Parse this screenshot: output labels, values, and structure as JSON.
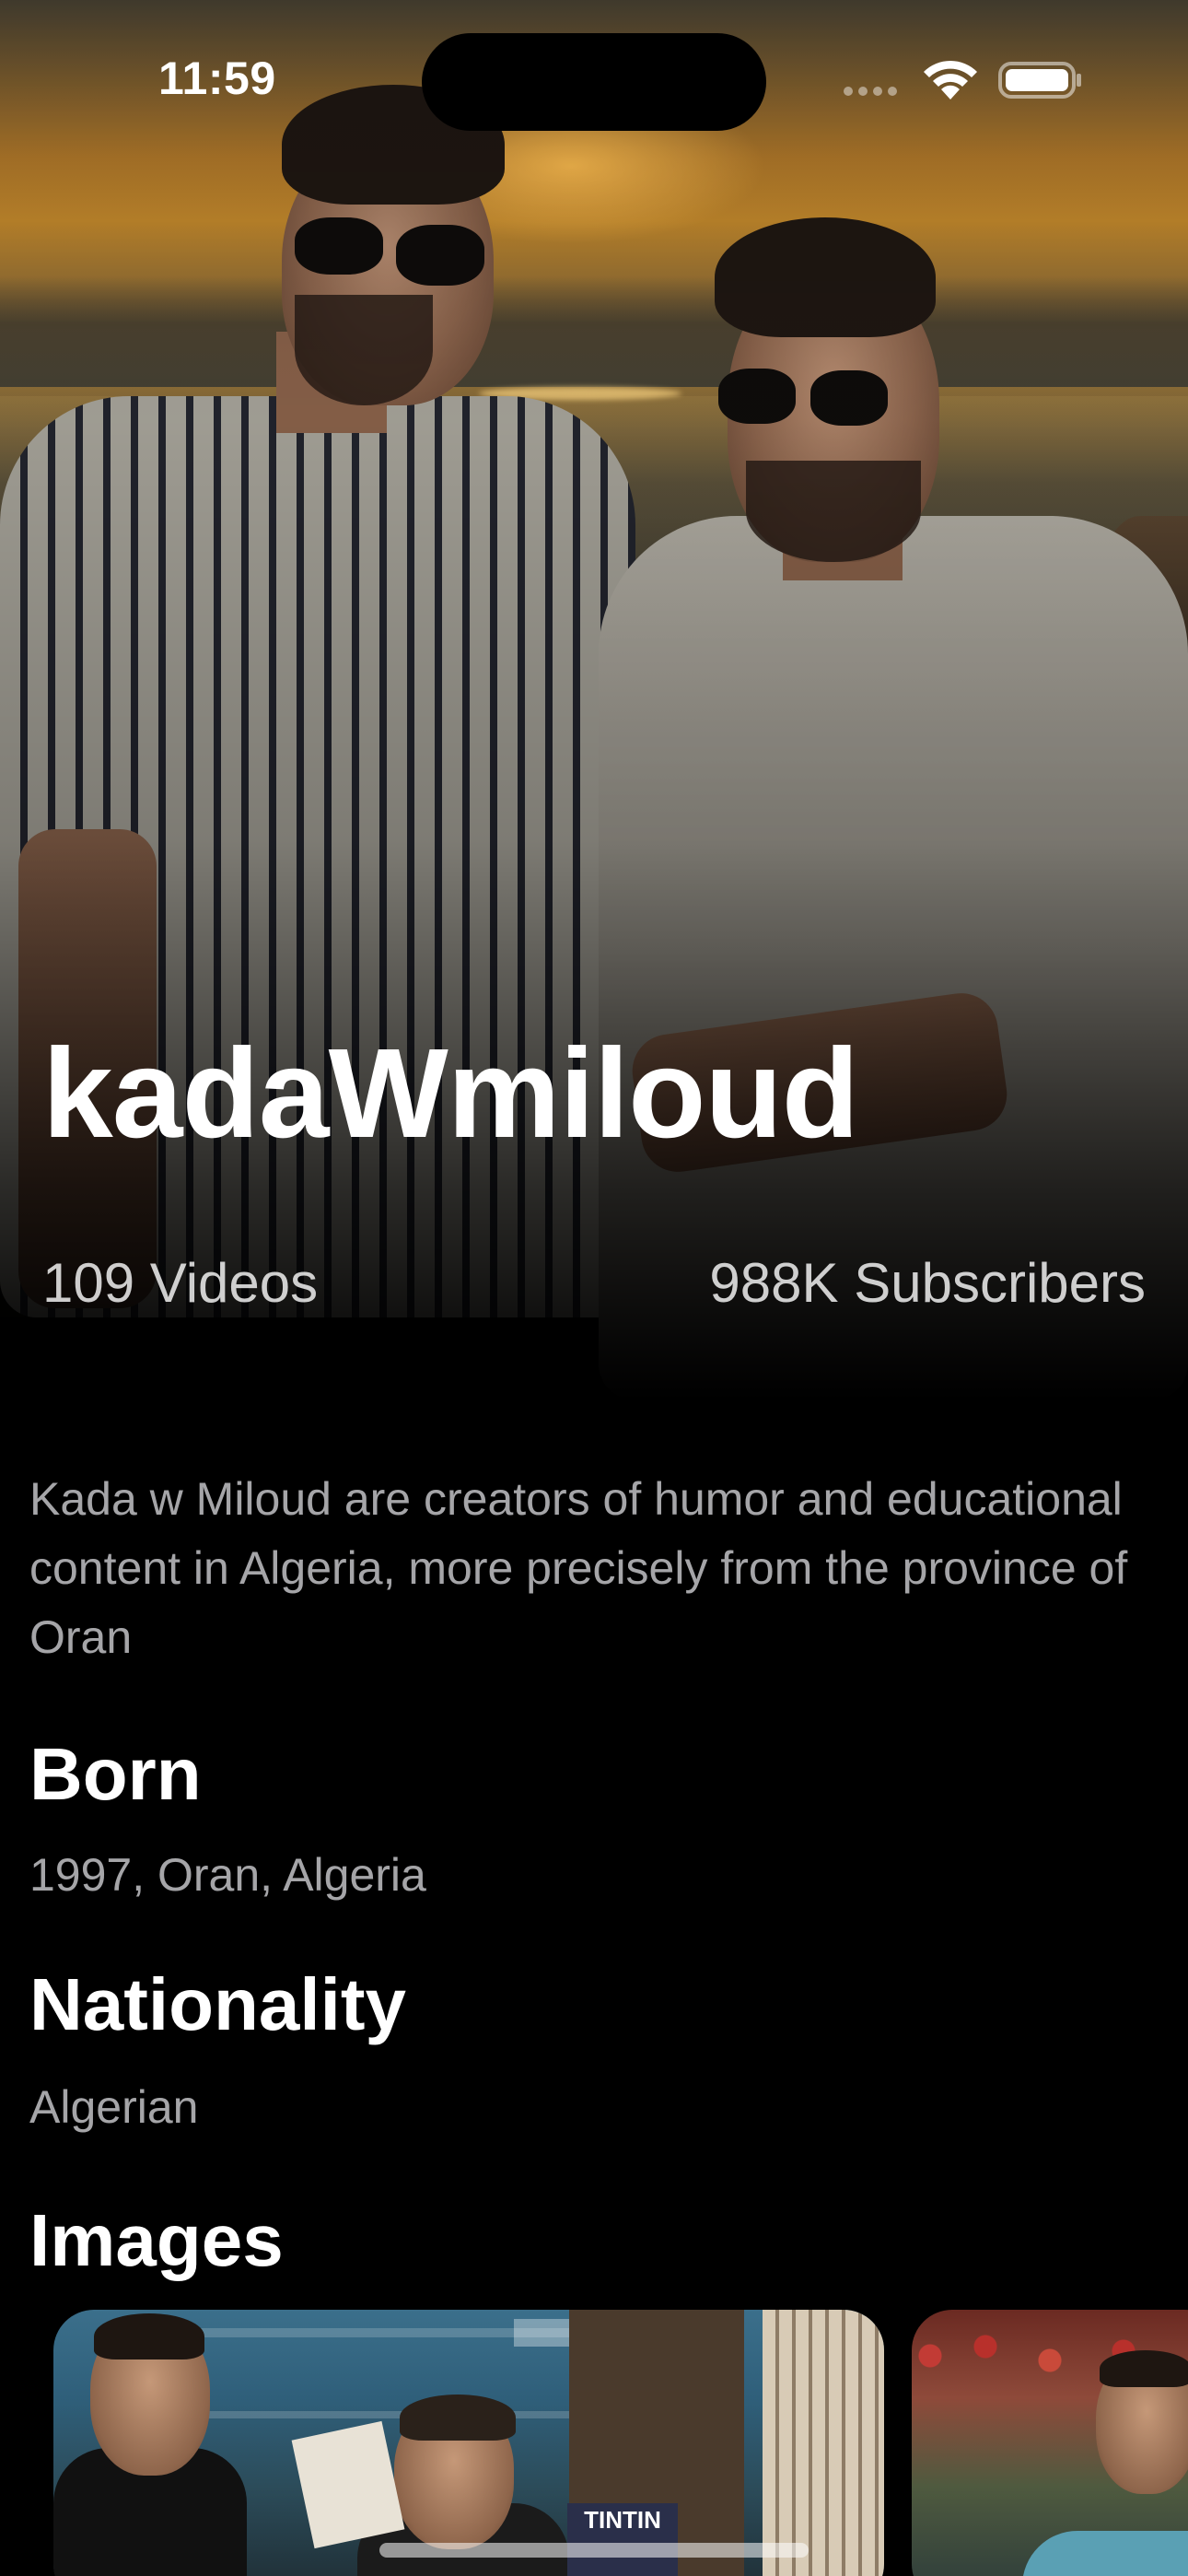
{
  "status_bar": {
    "time": "11:59",
    "icons": [
      "cellular-signal-icon",
      "wifi-icon",
      "battery-icon"
    ]
  },
  "channel": {
    "name": "kadaWmiloud",
    "videos": "109 Videos",
    "subscribers": "988K Subscribers",
    "description": "Kada w Miloud are creators of humor and educational content in Algeria, more precisely from the province of Oran"
  },
  "sections": {
    "born": {
      "title": "Born",
      "value": "1997, Oran, Algeria"
    },
    "nationality": {
      "title": "Nationality",
      "value": "Algerian"
    },
    "images": {
      "title": "Images"
    }
  },
  "carousel": {
    "book_title": "TINTIN"
  },
  "colors": {
    "background": "#000000",
    "primary_text": "#FFFFFF",
    "secondary_text": "#B8B8BC"
  }
}
